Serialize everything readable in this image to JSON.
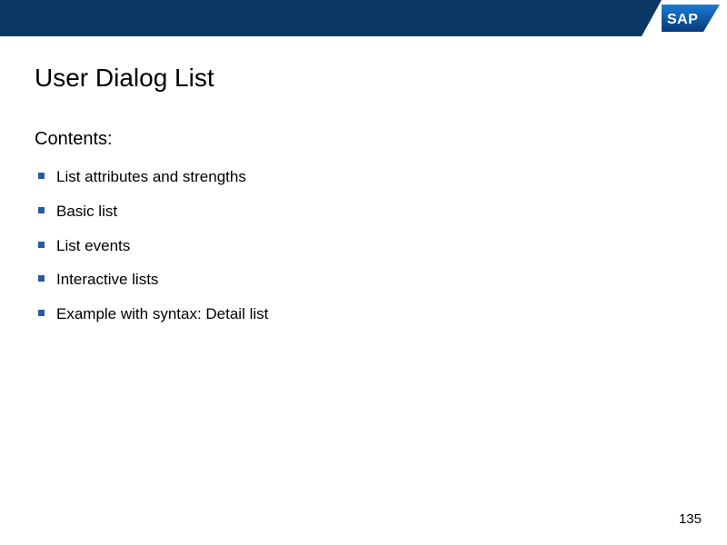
{
  "header": {
    "brand": "SAP"
  },
  "slide": {
    "title": "User Dialog List",
    "subheading": "Contents:",
    "bullets": [
      "List attributes and strengths",
      "Basic list",
      "List events",
      "Interactive lists",
      "Example with syntax: Detail list"
    ],
    "page_number": "135"
  },
  "colors": {
    "bar": "#0b3764",
    "bullet": "#2a5a9e"
  }
}
